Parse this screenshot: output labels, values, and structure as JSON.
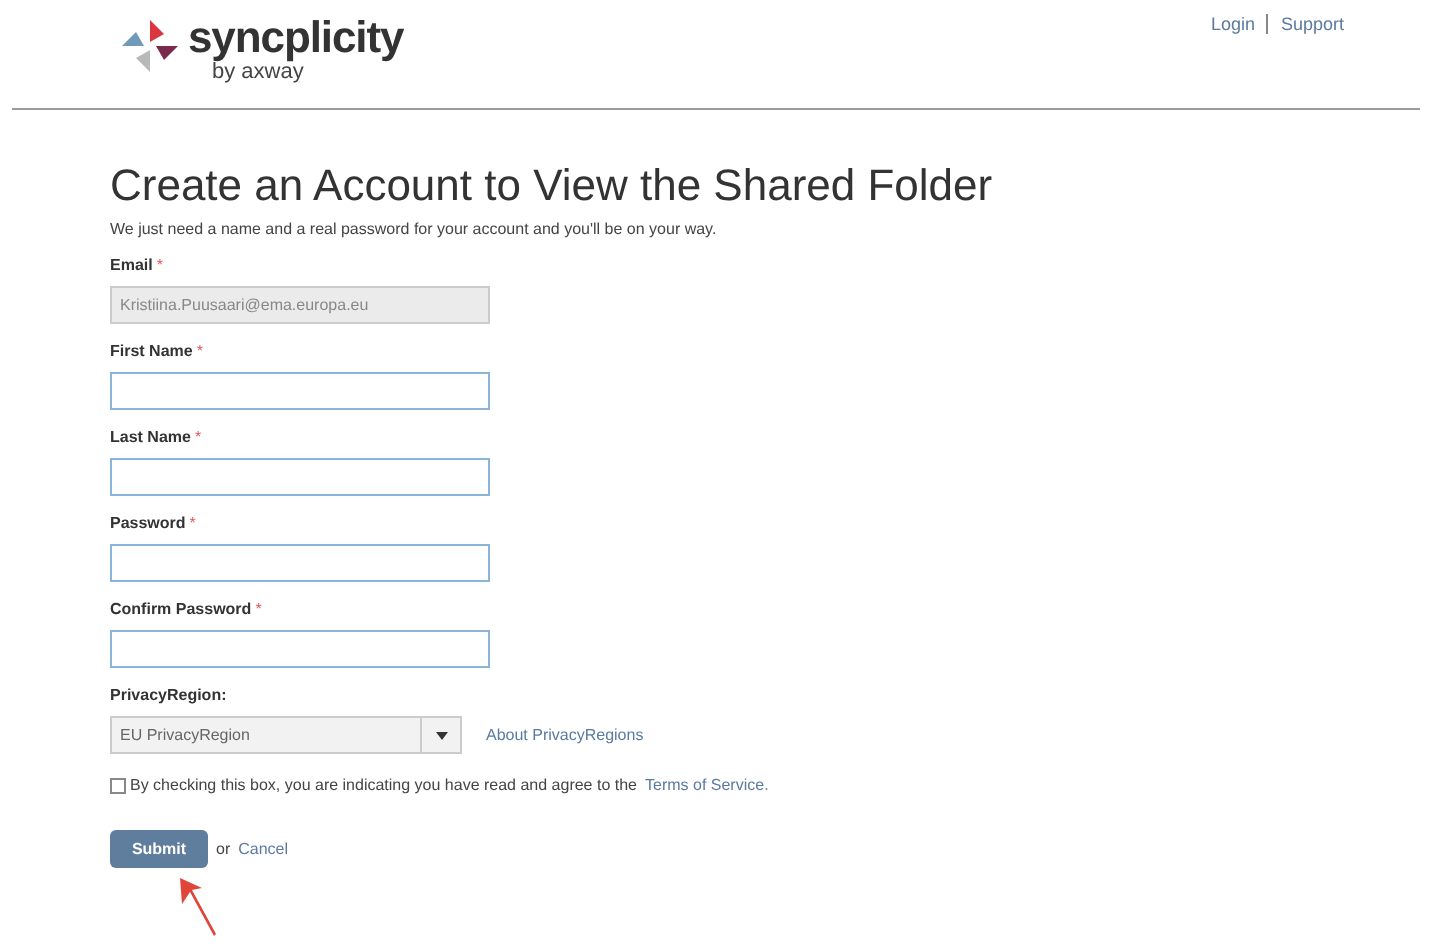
{
  "header": {
    "logo": {
      "name": "syncplicity",
      "tagline": "by axway"
    },
    "links": [
      "Login",
      "Support"
    ]
  },
  "title": "Create an Account to View the Shared Folder",
  "subtitle": "We just need a name and a real password for your account and you'll be on your way.",
  "fields": [
    {
      "label": "Email",
      "required_mark": "*",
      "value": "Kristiina.Puusaari@ema.europa.eu",
      "disabled": true
    },
    {
      "label": "First Name",
      "required_mark": "*",
      "disabled": false
    },
    {
      "label": "Last Name",
      "required_mark": "*",
      "disabled": false
    },
    {
      "label": "Password",
      "required_mark": "*",
      "disabled": false
    },
    {
      "label": "Confirm Password",
      "required_mark": "*",
      "disabled": false
    }
  ],
  "privacy": {
    "label": "PrivacyRegion:",
    "value": "EU PrivacyRegion",
    "link": "About PrivacyRegions"
  },
  "terms": {
    "checked": false,
    "text": "By checking this box, you are indicating you have read and agree to the",
    "link": "Terms of Service."
  },
  "actions": {
    "submit": "Submit",
    "or": "or",
    "cancel": "Cancel"
  },
  "annotation": {
    "kind": "arrow"
  }
}
